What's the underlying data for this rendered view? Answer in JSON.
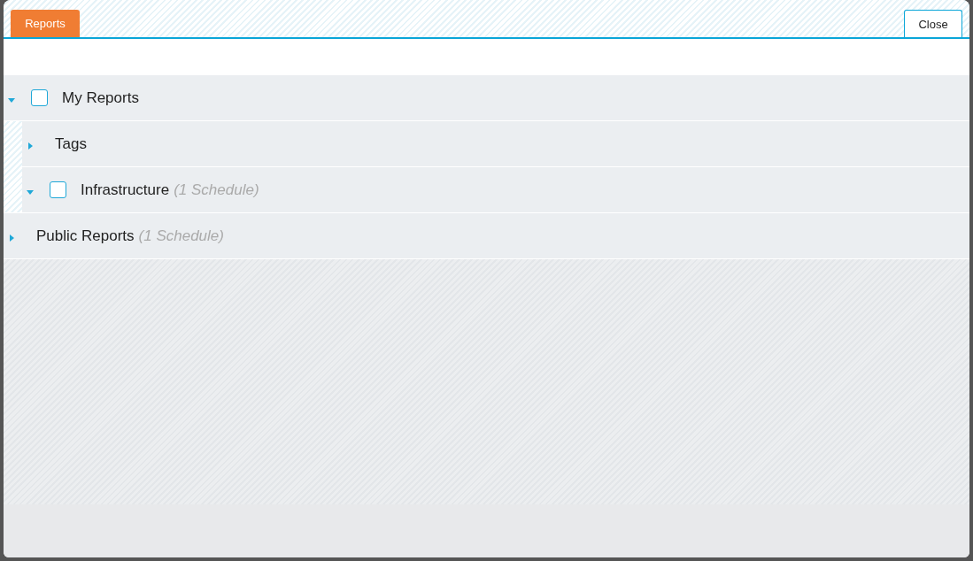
{
  "tabs": [
    {
      "label": "Reports",
      "selected": true
    }
  ],
  "close_button": "Close",
  "tree": [
    {
      "label": "My Reports",
      "expanded": true,
      "checked": false,
      "children": [
        {
          "label": "Tags",
          "expanded": false
        },
        {
          "label": "Infrastructure",
          "expanded": true,
          "checked": false,
          "count": "(1 Schedule)"
        }
      ]
    },
    {
      "label": "Public Reports",
      "expanded": false,
      "count": "(1 Schedule)"
    }
  ]
}
